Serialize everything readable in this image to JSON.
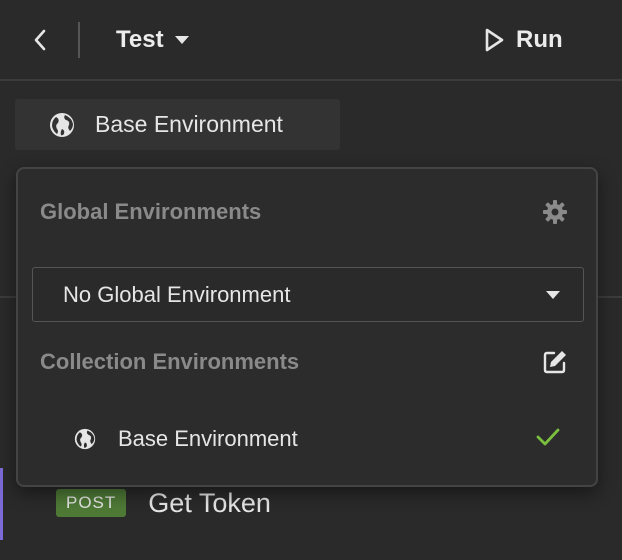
{
  "header": {
    "back_icon": "chevron-left-icon",
    "title": "Test",
    "title_dropdown_icon": "caret-down-icon",
    "run_icon": "play-icon",
    "run_label": "Run"
  },
  "environment_button": {
    "icon": "globe-icon",
    "label": "Base Environment"
  },
  "dropdown": {
    "global_section": {
      "title": "Global Environments",
      "settings_icon": "gear-icon",
      "select_value": "No Global Environment"
    },
    "collection_section": {
      "title": "Collection Environments",
      "edit_icon": "edit-icon",
      "items": [
        {
          "icon": "globe-icon",
          "label": "Base Environment",
          "selected": true
        }
      ]
    }
  },
  "request": {
    "method": "POST",
    "name": "Get Token"
  },
  "colors": {
    "background": "#2a2a2a",
    "method_post": "#4e7a36",
    "check": "#7bbf3e",
    "accent": "#7c6bd6",
    "muted_text": "#8a8a8a"
  }
}
